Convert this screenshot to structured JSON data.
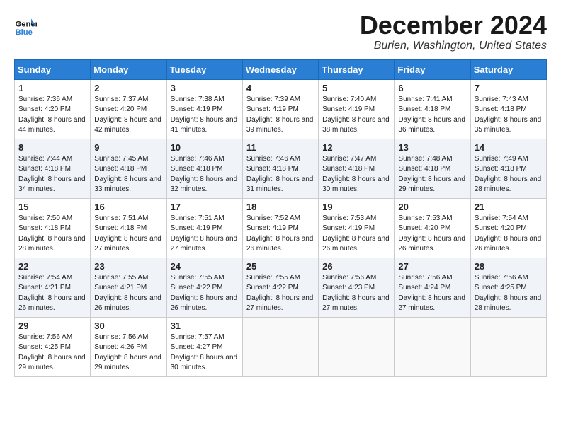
{
  "header": {
    "logo_line1": "General",
    "logo_line2": "Blue",
    "month_title": "December 2024",
    "location": "Burien, Washington, United States"
  },
  "weekdays": [
    "Sunday",
    "Monday",
    "Tuesday",
    "Wednesday",
    "Thursday",
    "Friday",
    "Saturday"
  ],
  "weeks": [
    [
      {
        "day": "1",
        "sunrise": "Sunrise: 7:36 AM",
        "sunset": "Sunset: 4:20 PM",
        "daylight": "Daylight: 8 hours and 44 minutes."
      },
      {
        "day": "2",
        "sunrise": "Sunrise: 7:37 AM",
        "sunset": "Sunset: 4:20 PM",
        "daylight": "Daylight: 8 hours and 42 minutes."
      },
      {
        "day": "3",
        "sunrise": "Sunrise: 7:38 AM",
        "sunset": "Sunset: 4:19 PM",
        "daylight": "Daylight: 8 hours and 41 minutes."
      },
      {
        "day": "4",
        "sunrise": "Sunrise: 7:39 AM",
        "sunset": "Sunset: 4:19 PM",
        "daylight": "Daylight: 8 hours and 39 minutes."
      },
      {
        "day": "5",
        "sunrise": "Sunrise: 7:40 AM",
        "sunset": "Sunset: 4:19 PM",
        "daylight": "Daylight: 8 hours and 38 minutes."
      },
      {
        "day": "6",
        "sunrise": "Sunrise: 7:41 AM",
        "sunset": "Sunset: 4:18 PM",
        "daylight": "Daylight: 8 hours and 36 minutes."
      },
      {
        "day": "7",
        "sunrise": "Sunrise: 7:43 AM",
        "sunset": "Sunset: 4:18 PM",
        "daylight": "Daylight: 8 hours and 35 minutes."
      }
    ],
    [
      {
        "day": "8",
        "sunrise": "Sunrise: 7:44 AM",
        "sunset": "Sunset: 4:18 PM",
        "daylight": "Daylight: 8 hours and 34 minutes."
      },
      {
        "day": "9",
        "sunrise": "Sunrise: 7:45 AM",
        "sunset": "Sunset: 4:18 PM",
        "daylight": "Daylight: 8 hours and 33 minutes."
      },
      {
        "day": "10",
        "sunrise": "Sunrise: 7:46 AM",
        "sunset": "Sunset: 4:18 PM",
        "daylight": "Daylight: 8 hours and 32 minutes."
      },
      {
        "day": "11",
        "sunrise": "Sunrise: 7:46 AM",
        "sunset": "Sunset: 4:18 PM",
        "daylight": "Daylight: 8 hours and 31 minutes."
      },
      {
        "day": "12",
        "sunrise": "Sunrise: 7:47 AM",
        "sunset": "Sunset: 4:18 PM",
        "daylight": "Daylight: 8 hours and 30 minutes."
      },
      {
        "day": "13",
        "sunrise": "Sunrise: 7:48 AM",
        "sunset": "Sunset: 4:18 PM",
        "daylight": "Daylight: 8 hours and 29 minutes."
      },
      {
        "day": "14",
        "sunrise": "Sunrise: 7:49 AM",
        "sunset": "Sunset: 4:18 PM",
        "daylight": "Daylight: 8 hours and 28 minutes."
      }
    ],
    [
      {
        "day": "15",
        "sunrise": "Sunrise: 7:50 AM",
        "sunset": "Sunset: 4:18 PM",
        "daylight": "Daylight: 8 hours and 28 minutes."
      },
      {
        "day": "16",
        "sunrise": "Sunrise: 7:51 AM",
        "sunset": "Sunset: 4:18 PM",
        "daylight": "Daylight: 8 hours and 27 minutes."
      },
      {
        "day": "17",
        "sunrise": "Sunrise: 7:51 AM",
        "sunset": "Sunset: 4:19 PM",
        "daylight": "Daylight: 8 hours and 27 minutes."
      },
      {
        "day": "18",
        "sunrise": "Sunrise: 7:52 AM",
        "sunset": "Sunset: 4:19 PM",
        "daylight": "Daylight: 8 hours and 26 minutes."
      },
      {
        "day": "19",
        "sunrise": "Sunrise: 7:53 AM",
        "sunset": "Sunset: 4:19 PM",
        "daylight": "Daylight: 8 hours and 26 minutes."
      },
      {
        "day": "20",
        "sunrise": "Sunrise: 7:53 AM",
        "sunset": "Sunset: 4:20 PM",
        "daylight": "Daylight: 8 hours and 26 minutes."
      },
      {
        "day": "21",
        "sunrise": "Sunrise: 7:54 AM",
        "sunset": "Sunset: 4:20 PM",
        "daylight": "Daylight: 8 hours and 26 minutes."
      }
    ],
    [
      {
        "day": "22",
        "sunrise": "Sunrise: 7:54 AM",
        "sunset": "Sunset: 4:21 PM",
        "daylight": "Daylight: 8 hours and 26 minutes."
      },
      {
        "day": "23",
        "sunrise": "Sunrise: 7:55 AM",
        "sunset": "Sunset: 4:21 PM",
        "daylight": "Daylight: 8 hours and 26 minutes."
      },
      {
        "day": "24",
        "sunrise": "Sunrise: 7:55 AM",
        "sunset": "Sunset: 4:22 PM",
        "daylight": "Daylight: 8 hours and 26 minutes."
      },
      {
        "day": "25",
        "sunrise": "Sunrise: 7:55 AM",
        "sunset": "Sunset: 4:22 PM",
        "daylight": "Daylight: 8 hours and 27 minutes."
      },
      {
        "day": "26",
        "sunrise": "Sunrise: 7:56 AM",
        "sunset": "Sunset: 4:23 PM",
        "daylight": "Daylight: 8 hours and 27 minutes."
      },
      {
        "day": "27",
        "sunrise": "Sunrise: 7:56 AM",
        "sunset": "Sunset: 4:24 PM",
        "daylight": "Daylight: 8 hours and 27 minutes."
      },
      {
        "day": "28",
        "sunrise": "Sunrise: 7:56 AM",
        "sunset": "Sunset: 4:25 PM",
        "daylight": "Daylight: 8 hours and 28 minutes."
      }
    ],
    [
      {
        "day": "29",
        "sunrise": "Sunrise: 7:56 AM",
        "sunset": "Sunset: 4:25 PM",
        "daylight": "Daylight: 8 hours and 29 minutes."
      },
      {
        "day": "30",
        "sunrise": "Sunrise: 7:56 AM",
        "sunset": "Sunset: 4:26 PM",
        "daylight": "Daylight: 8 hours and 29 minutes."
      },
      {
        "day": "31",
        "sunrise": "Sunrise: 7:57 AM",
        "sunset": "Sunset: 4:27 PM",
        "daylight": "Daylight: 8 hours and 30 minutes."
      },
      null,
      null,
      null,
      null
    ]
  ]
}
